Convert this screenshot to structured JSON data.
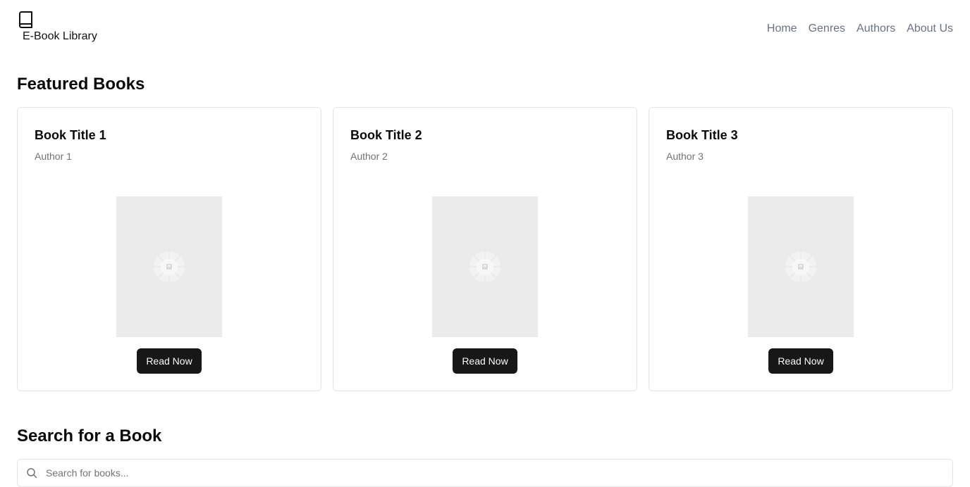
{
  "brand": {
    "name": "E-Book Library",
    "icon": "book-icon"
  },
  "nav": {
    "items": [
      {
        "label": "Home"
      },
      {
        "label": "Genres"
      },
      {
        "label": "Authors"
      },
      {
        "label": "About Us"
      }
    ]
  },
  "featured": {
    "title": "Featured Books",
    "books": [
      {
        "title": "Book Title 1",
        "author": "Author 1",
        "button_label": "Read Now",
        "cover_icon": "image-placeholder-icon"
      },
      {
        "title": "Book Title 2",
        "author": "Author 2",
        "button_label": "Read Now",
        "cover_icon": "image-placeholder-icon"
      },
      {
        "title": "Book Title 3",
        "author": "Author 3",
        "button_label": "Read Now",
        "cover_icon": "image-placeholder-icon"
      }
    ]
  },
  "search": {
    "title": "Search for a Book",
    "placeholder": "Search for books...",
    "value": "",
    "icon": "search-icon"
  },
  "colors": {
    "primary_button": "#171717",
    "muted_text": "#737373",
    "nav_text": "#6b7280",
    "border": "#e5e5e5",
    "cover_placeholder": "#ebebeb"
  }
}
